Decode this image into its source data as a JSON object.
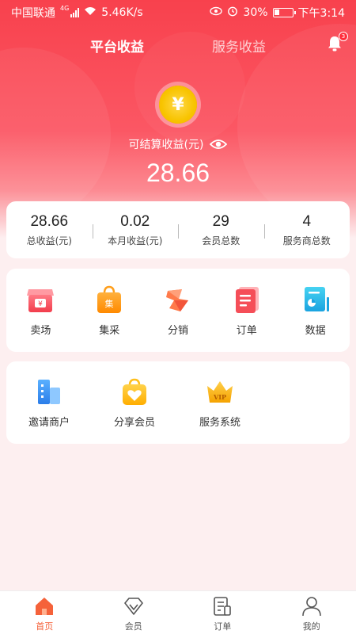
{
  "status_bar": {
    "carrier": "中国联通",
    "network": "4G",
    "speed": "5.46K/s",
    "battery": "30%",
    "battery_level": 0.3,
    "time": "下午3:14"
  },
  "header": {
    "tabs": [
      {
        "label": "平台收益",
        "active": true
      },
      {
        "label": "服务收益",
        "active": false
      }
    ],
    "notification_count": "3"
  },
  "balance": {
    "currency_symbol": "¥",
    "label": "可结算收益(元)",
    "value": "28.66"
  },
  "stats": [
    {
      "value": "28.66",
      "label": "总收益(元)"
    },
    {
      "value": "0.02",
      "label": "本月收益(元)"
    },
    {
      "value": "29",
      "label": "会员总数"
    },
    {
      "value": "4",
      "label": "服务商总数"
    }
  ],
  "features": [
    {
      "label": "卖场",
      "icon": "store-icon"
    },
    {
      "label": "集采",
      "icon": "shopping-bag-icon",
      "icon_text": "集"
    },
    {
      "label": "分销",
      "icon": "distribution-icon"
    },
    {
      "label": "订单",
      "icon": "order-icon"
    },
    {
      "label": "数据",
      "icon": "data-icon"
    }
  ],
  "services": [
    {
      "label": "邀请商户",
      "icon": "invite-merchant-icon"
    },
    {
      "label": "分享会员",
      "icon": "share-member-icon"
    },
    {
      "label": "服务系统",
      "icon": "vip-crown-icon",
      "icon_text": "VIP"
    }
  ],
  "bottom_nav": [
    {
      "label": "首页",
      "icon": "home-icon",
      "active": true
    },
    {
      "label": "会员",
      "icon": "diamond-icon",
      "active": false
    },
    {
      "label": "订单",
      "icon": "order-list-icon",
      "active": false
    },
    {
      "label": "我的",
      "icon": "user-icon",
      "active": false
    }
  ],
  "colors": {
    "brand_red": "#f8414d",
    "accent_orange": "#f5623a",
    "coin_yellow": "#f8c400"
  }
}
